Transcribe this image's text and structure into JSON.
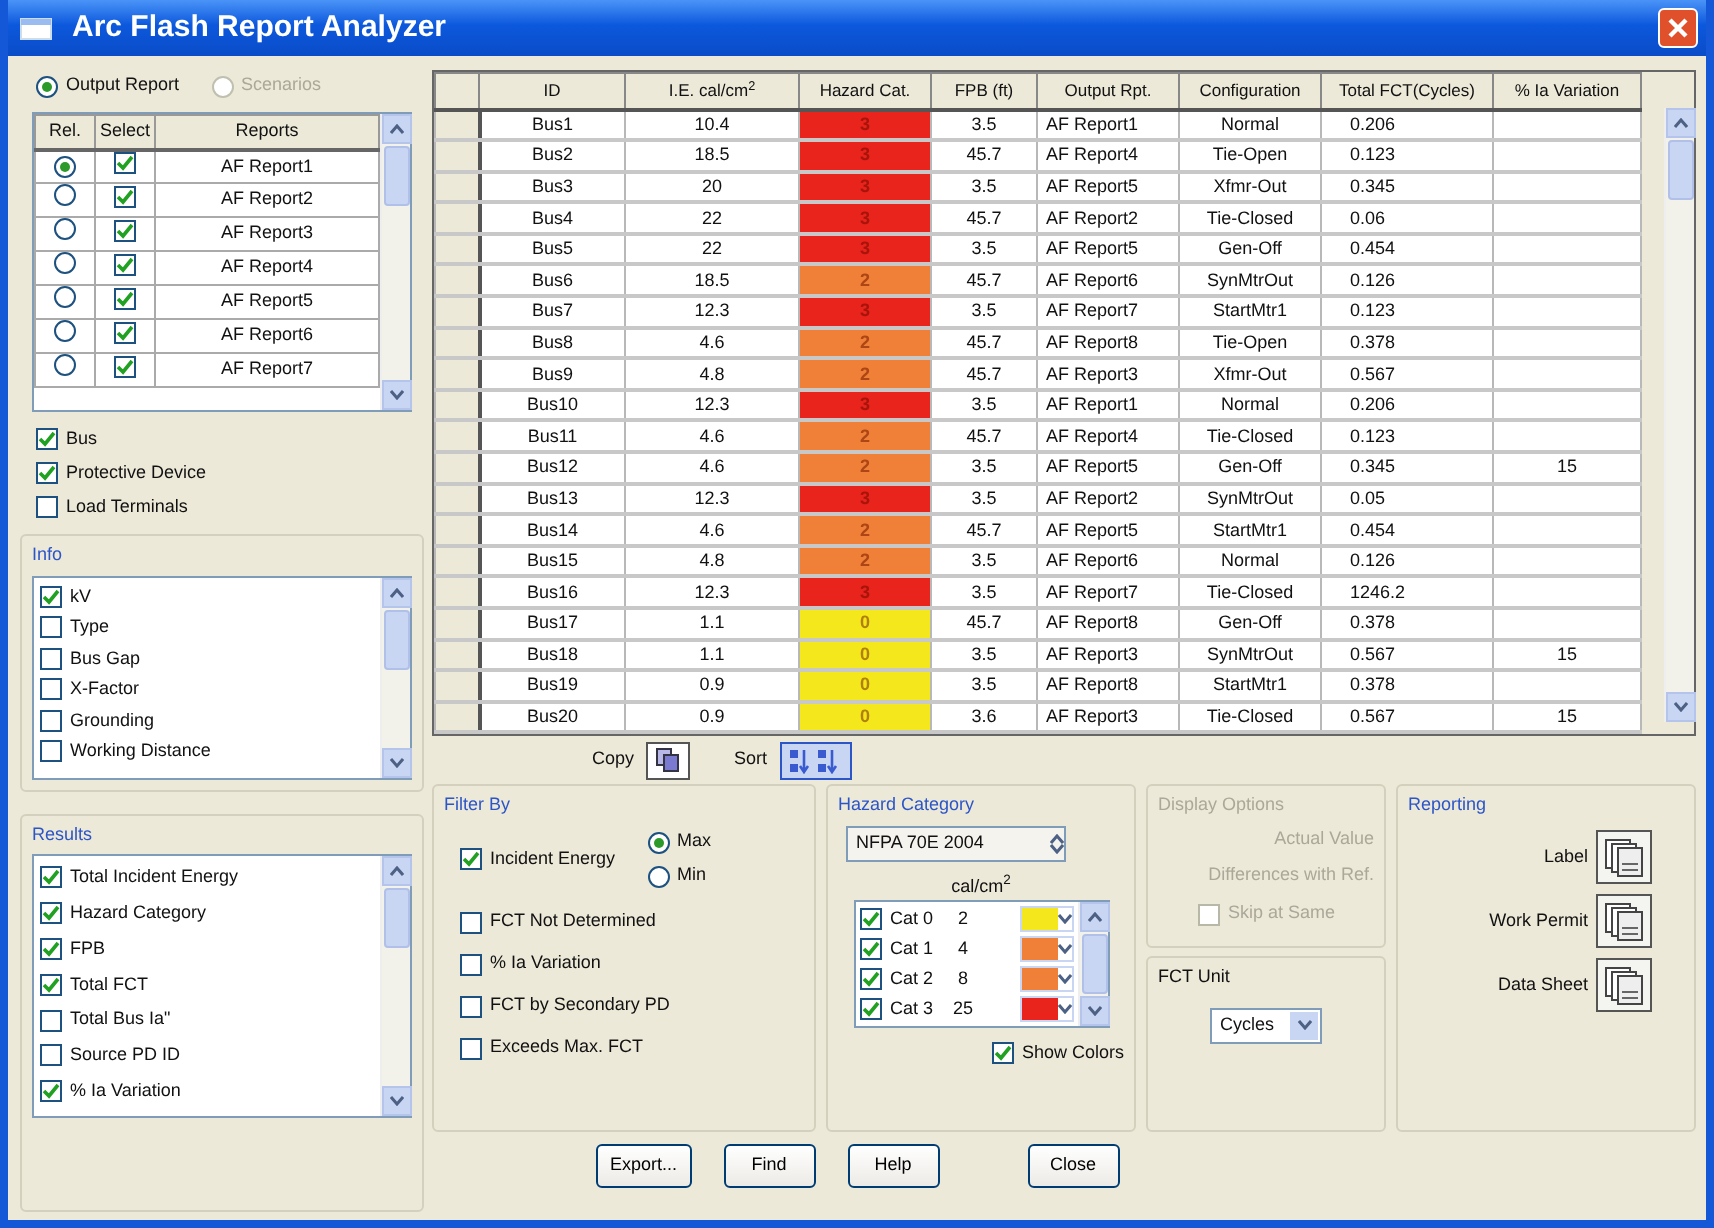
{
  "window": {
    "title": "Arc Flash Report Analyzer"
  },
  "mode_radios": [
    {
      "label": "Output Report",
      "selected": true,
      "disabled": false
    },
    {
      "label": "Scenarios",
      "selected": false,
      "disabled": true
    }
  ],
  "reports_table": {
    "columns": [
      "Rel.",
      "Select",
      "Reports"
    ],
    "rows": [
      {
        "name": "AF Report1",
        "selected": true,
        "checked": true
      },
      {
        "name": "AF Report2",
        "selected": false,
        "checked": true
      },
      {
        "name": "AF Report3",
        "selected": false,
        "checked": true
      },
      {
        "name": "AF Report4",
        "selected": false,
        "checked": true
      },
      {
        "name": "AF Report5",
        "selected": false,
        "checked": true
      },
      {
        "name": "AF Report6",
        "selected": false,
        "checked": true
      },
      {
        "name": "AF Report7",
        "selected": false,
        "checked": true
      }
    ]
  },
  "element_checks": [
    {
      "label": "Bus",
      "checked": true
    },
    {
      "label": "Protective Device",
      "checked": true
    },
    {
      "label": "Load Terminals",
      "checked": false
    }
  ],
  "info": {
    "title": "Info",
    "items": [
      {
        "label": "kV",
        "checked": true
      },
      {
        "label": "Type",
        "checked": false
      },
      {
        "label": "Bus Gap",
        "checked": false
      },
      {
        "label": "X-Factor",
        "checked": false
      },
      {
        "label": "Grounding",
        "checked": false
      },
      {
        "label": "Working Distance",
        "checked": false
      }
    ]
  },
  "results": {
    "title": "Results",
    "items": [
      {
        "label": "Total Incident Energy",
        "checked": true
      },
      {
        "label": "Hazard Category",
        "checked": true
      },
      {
        "label": "FPB",
        "checked": true
      },
      {
        "label": "Total FCT",
        "checked": true
      },
      {
        "label": "Total Bus Ia\"",
        "checked": false
      },
      {
        "label": "Source PD ID",
        "checked": false
      },
      {
        "label": "% Ia Variation",
        "checked": true
      }
    ]
  },
  "grid": {
    "columns": [
      "ID",
      "I.E. cal/cm$^{2}$",
      "Hazard Cat.",
      "FPB (ft)",
      "Output Rpt.",
      "Configuration",
      "Total FCT(Cycles)",
      "% Ia Variation"
    ],
    "rows": [
      {
        "id": "Bus1",
        "ie": "10.4",
        "hazard": "3",
        "color": "#e8241c",
        "fpb": "3.5",
        "output": "AF Report1",
        "config": "Normal",
        "fct": "0.206"
      },
      {
        "id": "Bus2",
        "ie": "18.5",
        "hazard": "3",
        "color": "#e8241c",
        "fpb": "45.7",
        "output": "AF Report4",
        "config": "Tie-Open",
        "fct": "0.123"
      },
      {
        "id": "Bus3",
        "ie": "20",
        "hazard": "3",
        "color": "#e8241c",
        "fpb": "3.5",
        "output": "AF Report5",
        "config": "Xfmr-Out",
        "fct": "0.345"
      },
      {
        "id": "Bus4",
        "ie": "22",
        "hazard": "3",
        "color": "#e8241c",
        "fpb": "45.7",
        "output": "AF Report2",
        "config": "Tie-Closed",
        "fct": "0.06"
      },
      {
        "id": "Bus5",
        "ie": "22",
        "hazard": "3",
        "color": "#e8241c",
        "fpb": "3.5",
        "output": "AF Report5",
        "config": "Gen-Off",
        "fct": "0.454"
      },
      {
        "id": "Bus6",
        "ie": "18.5",
        "hazard": "2",
        "color": "#f08038",
        "fpb": "45.7",
        "output": "AF Report6",
        "config": "SynMtrOut",
        "fct": "0.126"
      },
      {
        "id": "Bus7",
        "ie": "12.3",
        "hazard": "3",
        "color": "#e8241c",
        "fpb": "3.5",
        "output": "AF Report7",
        "config": "StartMtr1",
        "fct": "0.123"
      },
      {
        "id": "Bus8",
        "ie": "4.6",
        "hazard": "2",
        "color": "#f08038",
        "fpb": "45.7",
        "output": "AF Report8",
        "config": "Tie-Open",
        "fct": "0.378"
      },
      {
        "id": "Bus9",
        "ie": "4.8",
        "hazard": "2",
        "color": "#f08038",
        "fpb": "45.7",
        "output": "AF Report3",
        "config": "Xfmr-Out",
        "fct": "0.567"
      },
      {
        "id": "Bus10",
        "ie": "12.3",
        "hazard": "3",
        "color": "#e8241c",
        "fpb": "3.5",
        "output": "AF Report1",
        "config": "Normal",
        "fct": "0.206"
      },
      {
        "id": "Bus11",
        "ie": "4.6",
        "hazard": "2",
        "color": "#f08038",
        "fpb": "45.7",
        "output": "AF Report4",
        "config": "Tie-Closed",
        "fct": "0.123"
      },
      {
        "id": "Bus12",
        "ie": "4.6",
        "hazard": "2",
        "color": "#f08038",
        "fpb": "3.5",
        "output": "AF Report5",
        "config": "Gen-Off",
        "fct": "0.345",
        "variation": "15"
      },
      {
        "id": "Bus13",
        "ie": "12.3",
        "hazard": "3",
        "color": "#e8241c",
        "fpb": "3.5",
        "output": "AF Report2",
        "config": "SynMtrOut",
        "fct": "0.05"
      },
      {
        "id": "Bus14",
        "ie": "4.6",
        "hazard": "2",
        "color": "#f08038",
        "fpb": "45.7",
        "output": "AF Report5",
        "config": "StartMtr1",
        "fct": "0.454"
      },
      {
        "id": "Bus15",
        "ie": "4.8",
        "hazard": "2",
        "color": "#f08038",
        "fpb": "3.5",
        "output": "AF Report6",
        "config": "Normal",
        "fct": "0.126"
      },
      {
        "id": "Bus16",
        "ie": "12.3",
        "hazard": "3",
        "color": "#e8241c",
        "fpb": "3.5",
        "output": "AF Report7",
        "config": "Tie-Closed",
        "fct": "1246.2"
      },
      {
        "id": "Bus17",
        "ie": "1.1",
        "hazard": "0",
        "color": "#f4e81c",
        "fpb": "45.7",
        "output": "AF Report8",
        "config": "Gen-Off",
        "fct": "0.378"
      },
      {
        "id": "Bus18",
        "ie": "1.1",
        "hazard": "0",
        "color": "#f4e81c",
        "fpb": "3.5",
        "output": "AF Report3",
        "config": "SynMtrOut",
        "fct": "0.567",
        "variation": "15"
      },
      {
        "id": "Bus19",
        "ie": "0.9",
        "hazard": "0",
        "color": "#f4e81c",
        "fpb": "3.5",
        "output": "AF Report8",
        "config": "StartMtr1",
        "fct": "0.378"
      },
      {
        "id": "Bus20",
        "ie": "0.9",
        "hazard": "0",
        "color": "#f4e81c",
        "fpb": "3.6",
        "output": "AF Report3",
        "config": "Tie-Closed",
        "fct": "0.567",
        "variation": "15"
      }
    ]
  },
  "copy_label": "Copy",
  "sort_label": "Sort",
  "filter_by": {
    "title": "Filter By",
    "incident_energy": {
      "label": "Incident Energy",
      "checked": true
    },
    "extremes": [
      {
        "label": "Max",
        "selected": true
      },
      {
        "label": "Min",
        "selected": false
      }
    ],
    "checks": [
      {
        "label": "FCT Not Determined",
        "checked": false
      },
      {
        "label": "% Ia Variation",
        "checked": false
      },
      {
        "label": "FCT by Secondary PD",
        "checked": false
      },
      {
        "label": "Exceeds Max. FCT",
        "checked": false
      }
    ]
  },
  "hazard_category": {
    "title": "Hazard Category",
    "standard": "NFPA 70E 2004",
    "unit": "cal/cm$^{2}$",
    "cats": [
      {
        "label": "Cat 0",
        "value": "2",
        "checked": true,
        "color": "#f4e81c"
      },
      {
        "label": "Cat 1",
        "value": "4",
        "checked": true,
        "color": "#f08038"
      },
      {
        "label": "Cat 2",
        "value": "8",
        "checked": true,
        "color": "#f08038"
      },
      {
        "label": "Cat 3",
        "value": "25",
        "checked": true,
        "color": "#e8241c"
      }
    ],
    "show_colors": {
      "label": "Show Colors",
      "checked": true
    }
  },
  "display_options": {
    "title": "Display Options",
    "disabled": true,
    "options": [
      "Actual Value",
      "Differences with Ref."
    ],
    "skip": {
      "label": "Skip at Same",
      "checked": false
    }
  },
  "fct_unit": {
    "title": "FCT Unit",
    "value": "Cycles"
  },
  "reporting": {
    "title": "Reporting",
    "items": [
      "Label",
      "Work Permit",
      "Data Sheet"
    ]
  },
  "buttons": [
    "Export...",
    "Find",
    "Help",
    "Close"
  ]
}
